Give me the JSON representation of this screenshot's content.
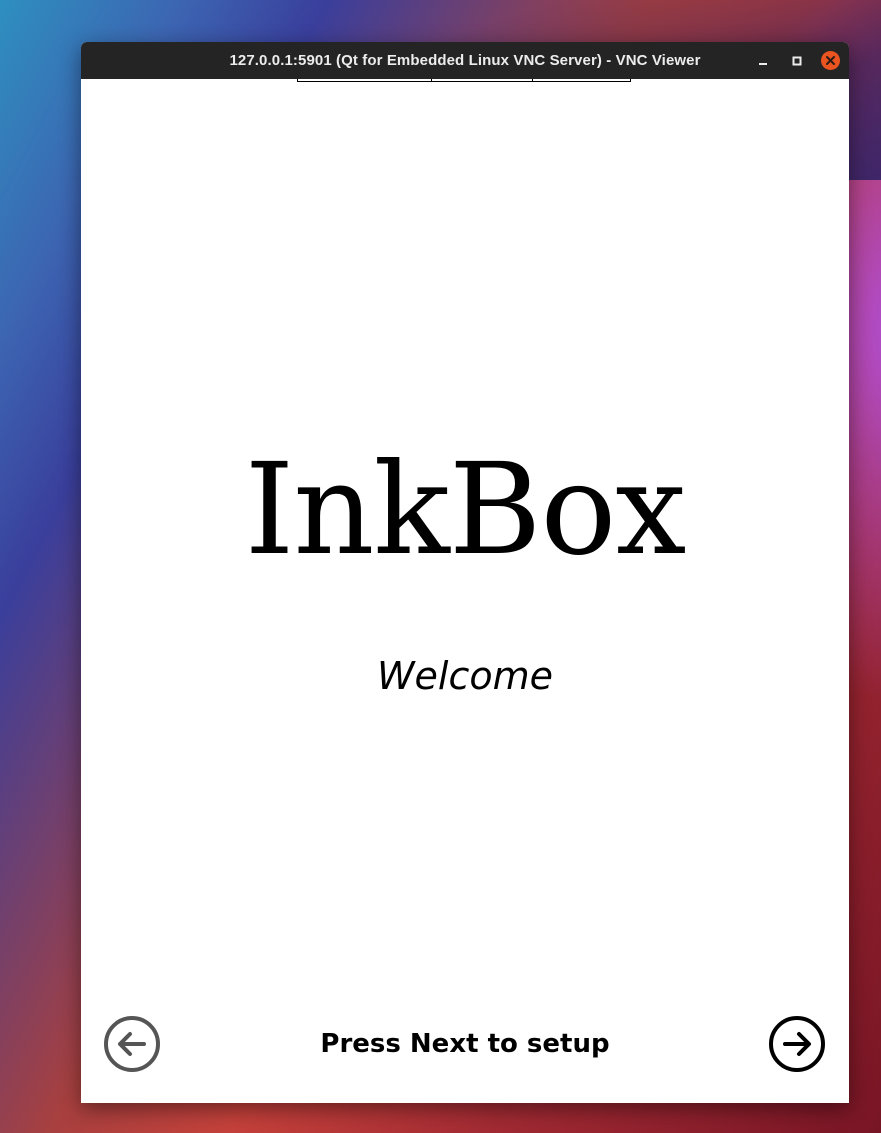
{
  "window": {
    "title": "127.0.0.1:5901 (Qt for Embedded Linux VNC Server) - VNC Viewer",
    "controls": {
      "minimize_icon": "minimize-icon",
      "maximize_icon": "maximize-icon",
      "close_icon": "close-icon",
      "close_color": "#e95420"
    }
  },
  "app": {
    "logo_text": "InkBox",
    "welcome_text": "Welcome",
    "footer_text": "Press Next to setup",
    "previous_icon": "arrow-left-circle-icon",
    "next_icon": "arrow-right-circle-icon",
    "previous_color": "#555555",
    "next_color": "#000000"
  }
}
